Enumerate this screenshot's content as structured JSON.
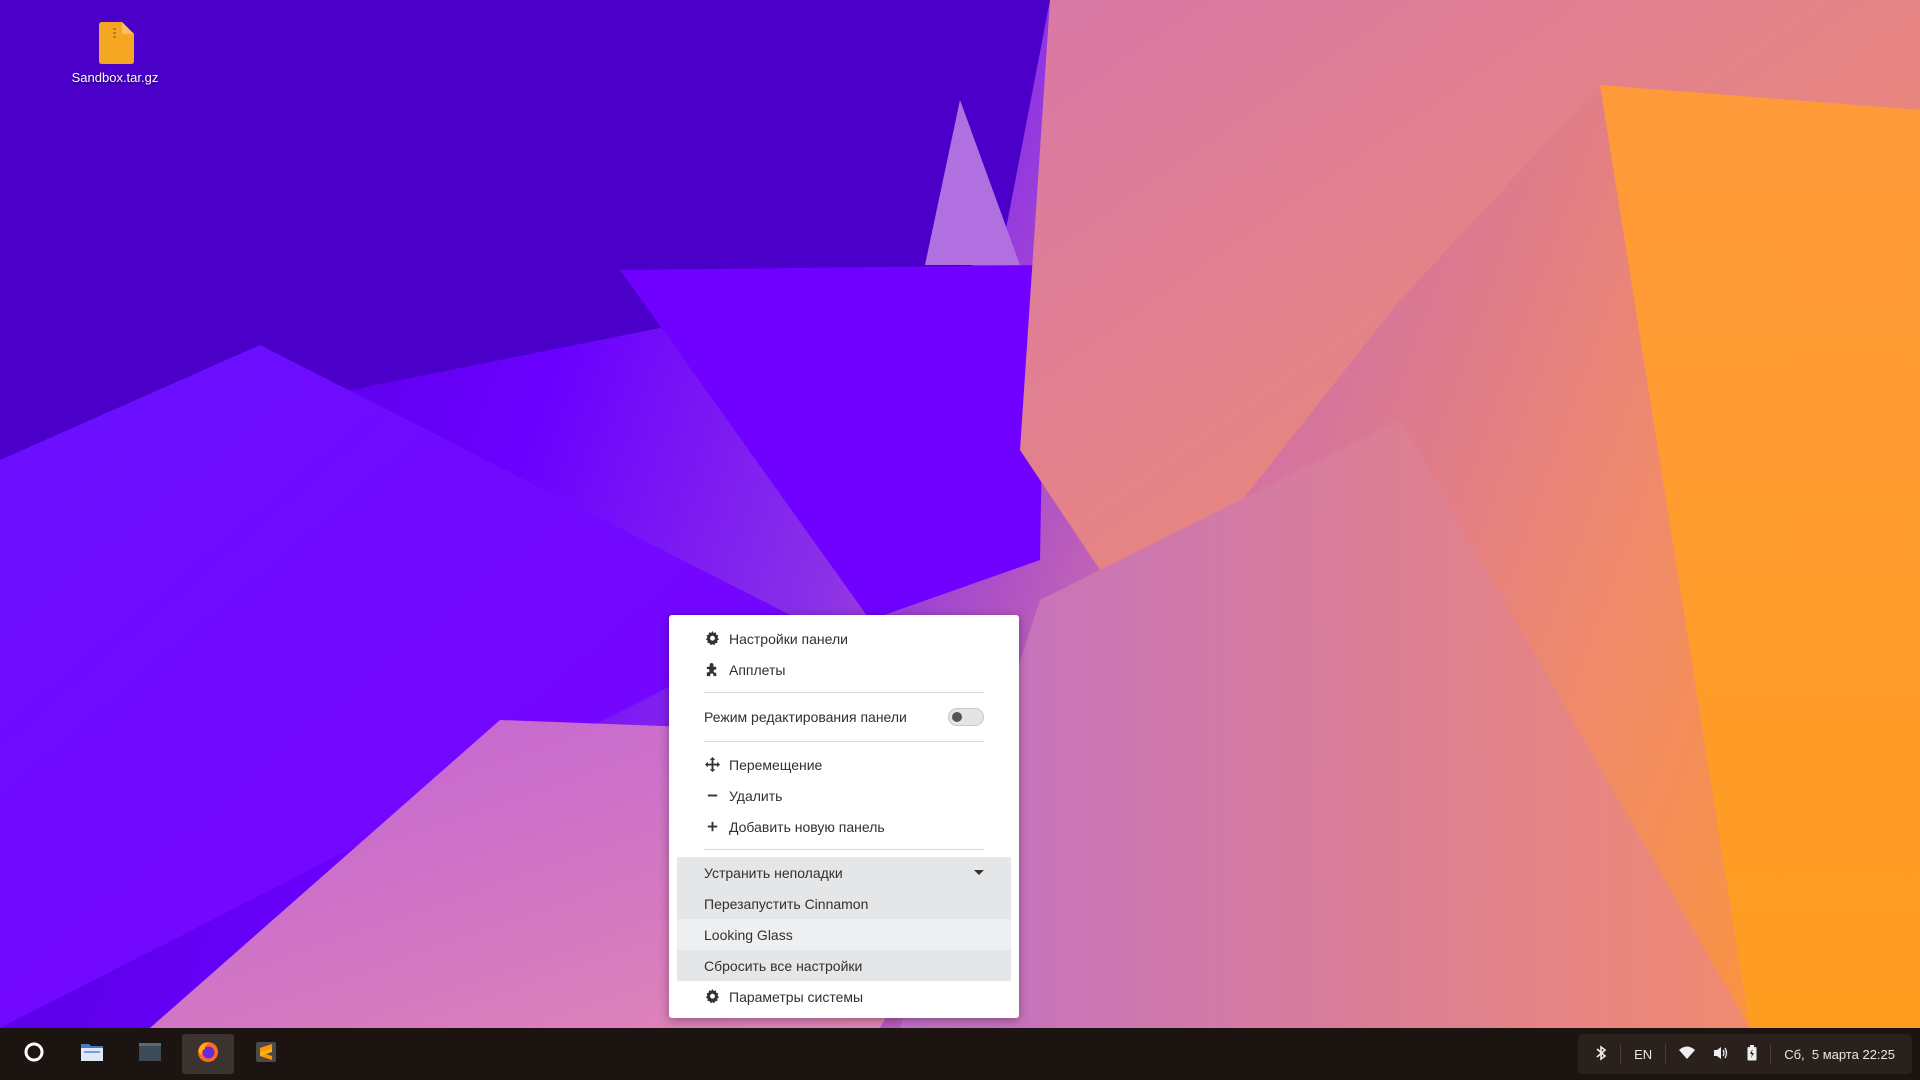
{
  "desktop": {
    "icons": [
      {
        "label": "Sandbox.tar.gz",
        "icon": "archive-file-icon",
        "color": "#f5a623"
      }
    ]
  },
  "context_menu": {
    "items": {
      "panel_settings": {
        "label": "Настройки панели",
        "icon": "gear-icon"
      },
      "applets": {
        "label": "Апплеты",
        "icon": "puzzle-icon"
      },
      "edit_mode": {
        "label": "Режим редактирования панели",
        "enabled": false
      },
      "move": {
        "label": "Перемещение",
        "icon": "move-arrows-icon"
      },
      "remove": {
        "label": "Удалить",
        "icon": "minus-icon"
      },
      "add_panel": {
        "label": "Добавить новую панель",
        "icon": "plus-icon"
      },
      "troubleshoot": {
        "label": "Устранить неполадки",
        "expanded": true
      },
      "restart_cinnamon": {
        "label": "Перезапустить Cinnamon"
      },
      "looking_glass": {
        "label": "Looking Glass"
      },
      "reset_settings": {
        "label": "Сбросить все настройки"
      },
      "system_settings": {
        "label": "Параметры системы",
        "icon": "gear-icon"
      }
    }
  },
  "taskbar": {
    "launchers": [
      {
        "name": "menu",
        "icon": "circle-menu-icon"
      },
      {
        "name": "files",
        "icon": "folder-icon"
      },
      {
        "name": "terminal",
        "icon": "terminal-icon"
      },
      {
        "name": "firefox",
        "icon": "firefox-icon",
        "active": true
      },
      {
        "name": "sublime",
        "icon": "sublime-text-icon"
      }
    ],
    "tray": {
      "bluetooth_icon": "bluetooth-icon",
      "keyboard_layout": "EN",
      "wifi_icon": "wifi-icon",
      "volume_icon": "volume-icon",
      "battery_icon": "battery-icon",
      "clock": "Сб,  5 марта 22:25"
    }
  },
  "colors": {
    "taskbar_bg": "#1c1410",
    "menu_bg": "#ffffff",
    "submenu_bg": "#e4e6e8"
  }
}
